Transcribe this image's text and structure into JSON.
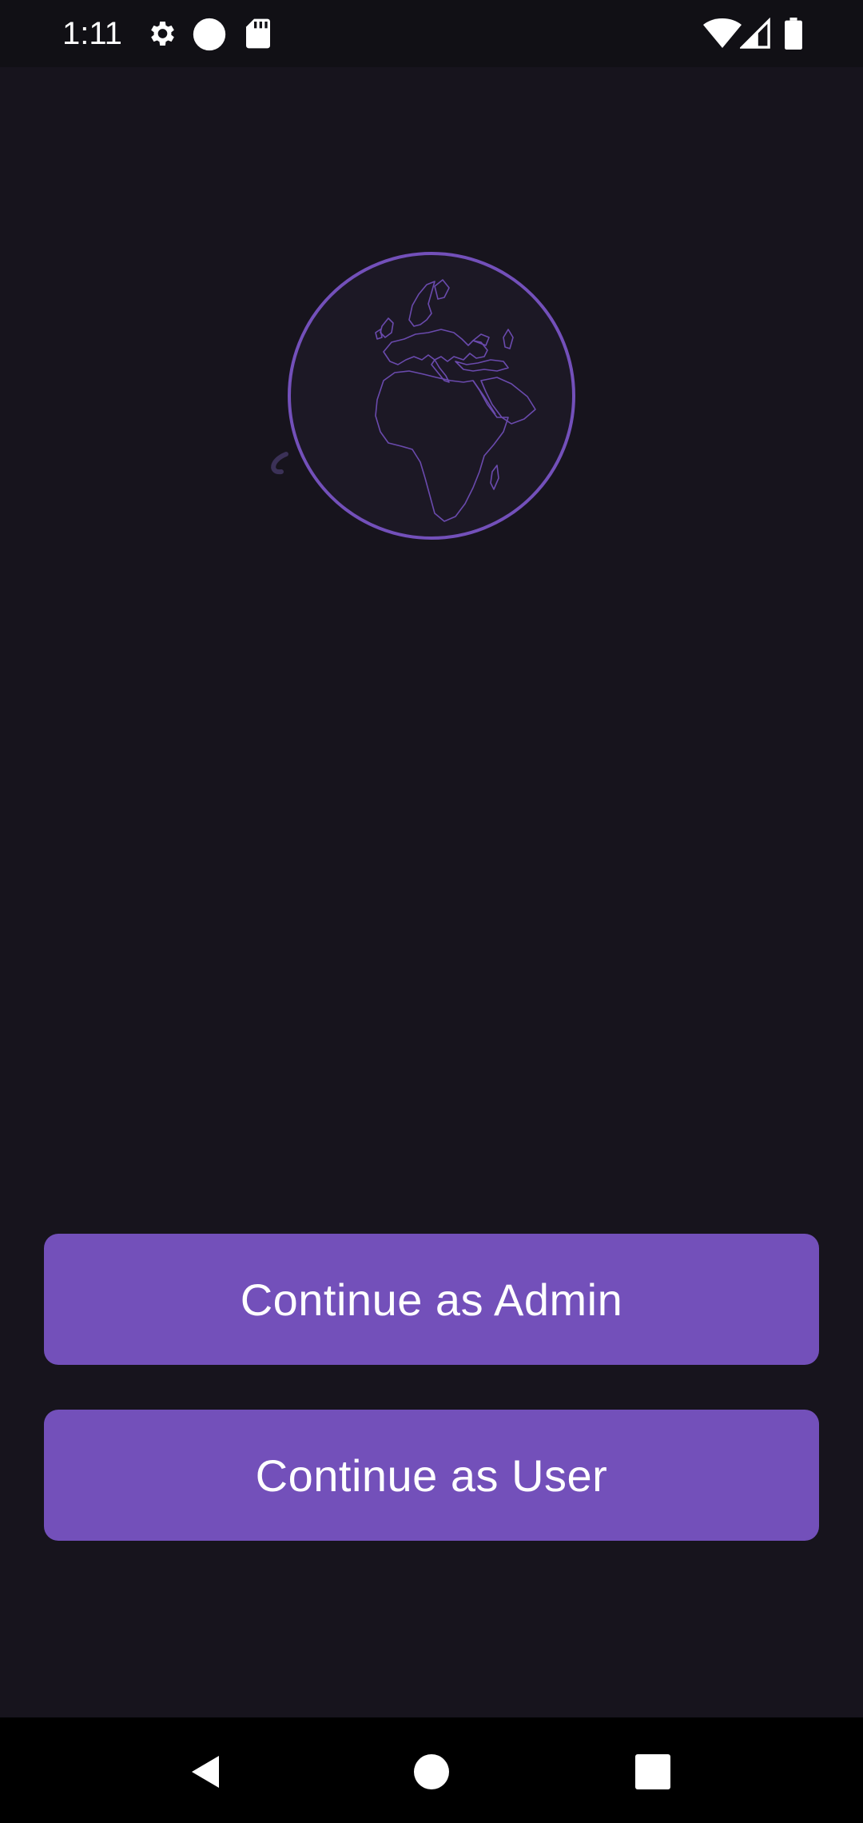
{
  "status_bar": {
    "time": "1:11",
    "left_icons": [
      "gear-icon",
      "circle-notification-icon",
      "sd-card-icon"
    ],
    "right_icons": [
      "wifi-icon",
      "signal-icon",
      "battery-icon"
    ]
  },
  "hero": {
    "icon": "globe-icon",
    "accent_color": "#7350ba"
  },
  "buttons": {
    "admin_label": "Continue as Admin",
    "user_label": "Continue as User"
  },
  "nav_bar": {
    "icons": [
      "back-icon",
      "home-icon",
      "recents-icon"
    ]
  },
  "colors": {
    "background": "#17141d",
    "button": "#7350ba",
    "text": "#ffffff"
  }
}
